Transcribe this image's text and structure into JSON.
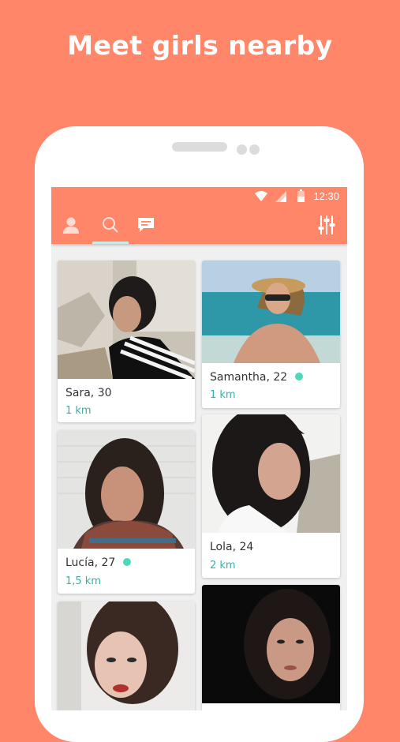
{
  "headline": "Meet girls nearby",
  "status": {
    "time": "12:30"
  },
  "colors": {
    "brand": "#FF8669",
    "accent": "#2fb3a7",
    "online": "#4fd8b8"
  },
  "tabs": [
    {
      "icon": "profile-icon"
    },
    {
      "icon": "search-icon",
      "active": true
    },
    {
      "icon": "chat-icon"
    }
  ],
  "filter": {
    "icon": "filter-sliders-icon"
  },
  "profiles": [
    {
      "name": "Sara, 30",
      "distance": "1 km",
      "online": false
    },
    {
      "name": "Samantha, 22",
      "distance": "1 km",
      "online": true
    },
    {
      "name": "Lucía, 27",
      "distance": "1,5 km",
      "online": true
    },
    {
      "name": "Lola, 24",
      "distance": "2 km",
      "online": false
    },
    {
      "name": "",
      "distance": "",
      "online": false
    },
    {
      "name": "",
      "distance": "",
      "online": false
    }
  ]
}
